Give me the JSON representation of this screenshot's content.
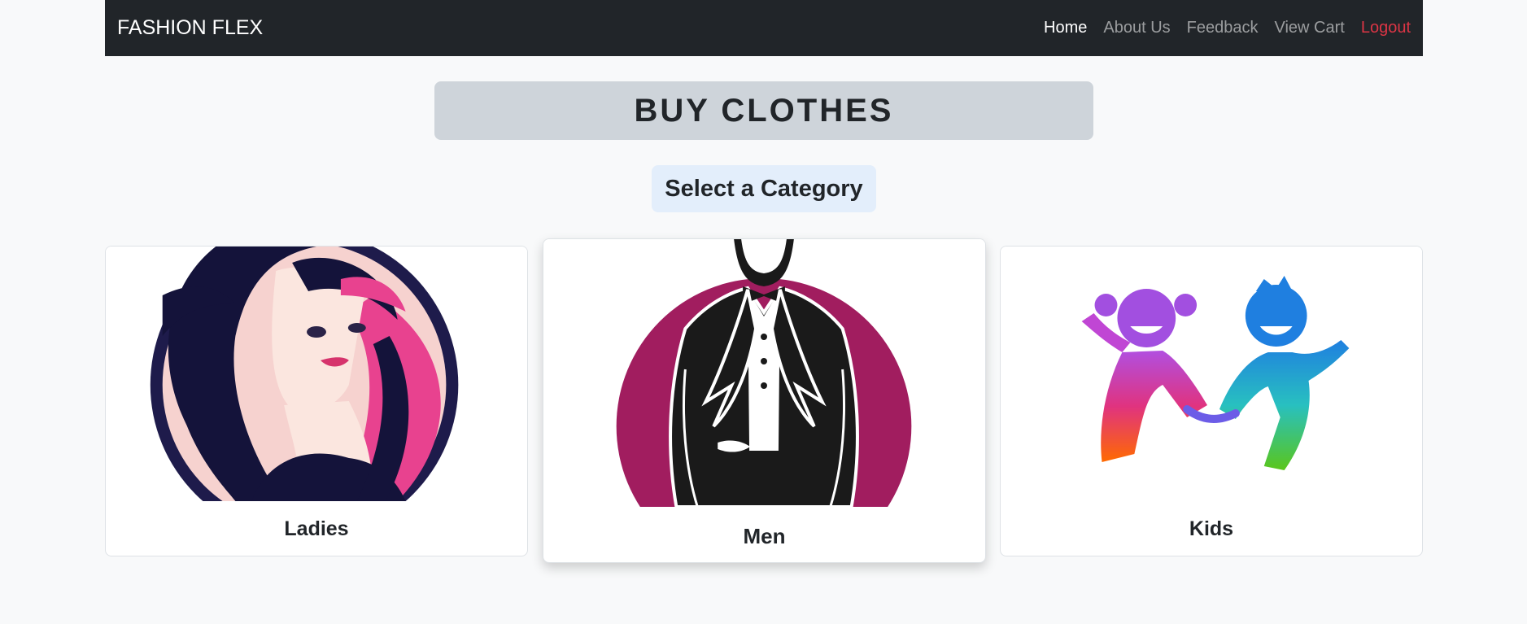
{
  "navbar": {
    "brand": "FASHION FLEX",
    "links": [
      {
        "label": "Home"
      },
      {
        "label": "About Us"
      },
      {
        "label": "Feedback"
      },
      {
        "label": "View Cart"
      },
      {
        "label": "Logout"
      }
    ],
    "colors": {
      "background": "#212529",
      "active": "#ffffff",
      "inactive": "#8c8f93",
      "logout": "#dc3545"
    }
  },
  "page": {
    "title": "BUY CLOTHES",
    "subtitle": "Select a Category"
  },
  "categories": [
    {
      "label": "Ladies",
      "icon": "woman-portrait-icon"
    },
    {
      "label": "Men",
      "icon": "tuxedo-man-icon"
    },
    {
      "label": "Kids",
      "icon": "kids-playing-icon"
    }
  ]
}
